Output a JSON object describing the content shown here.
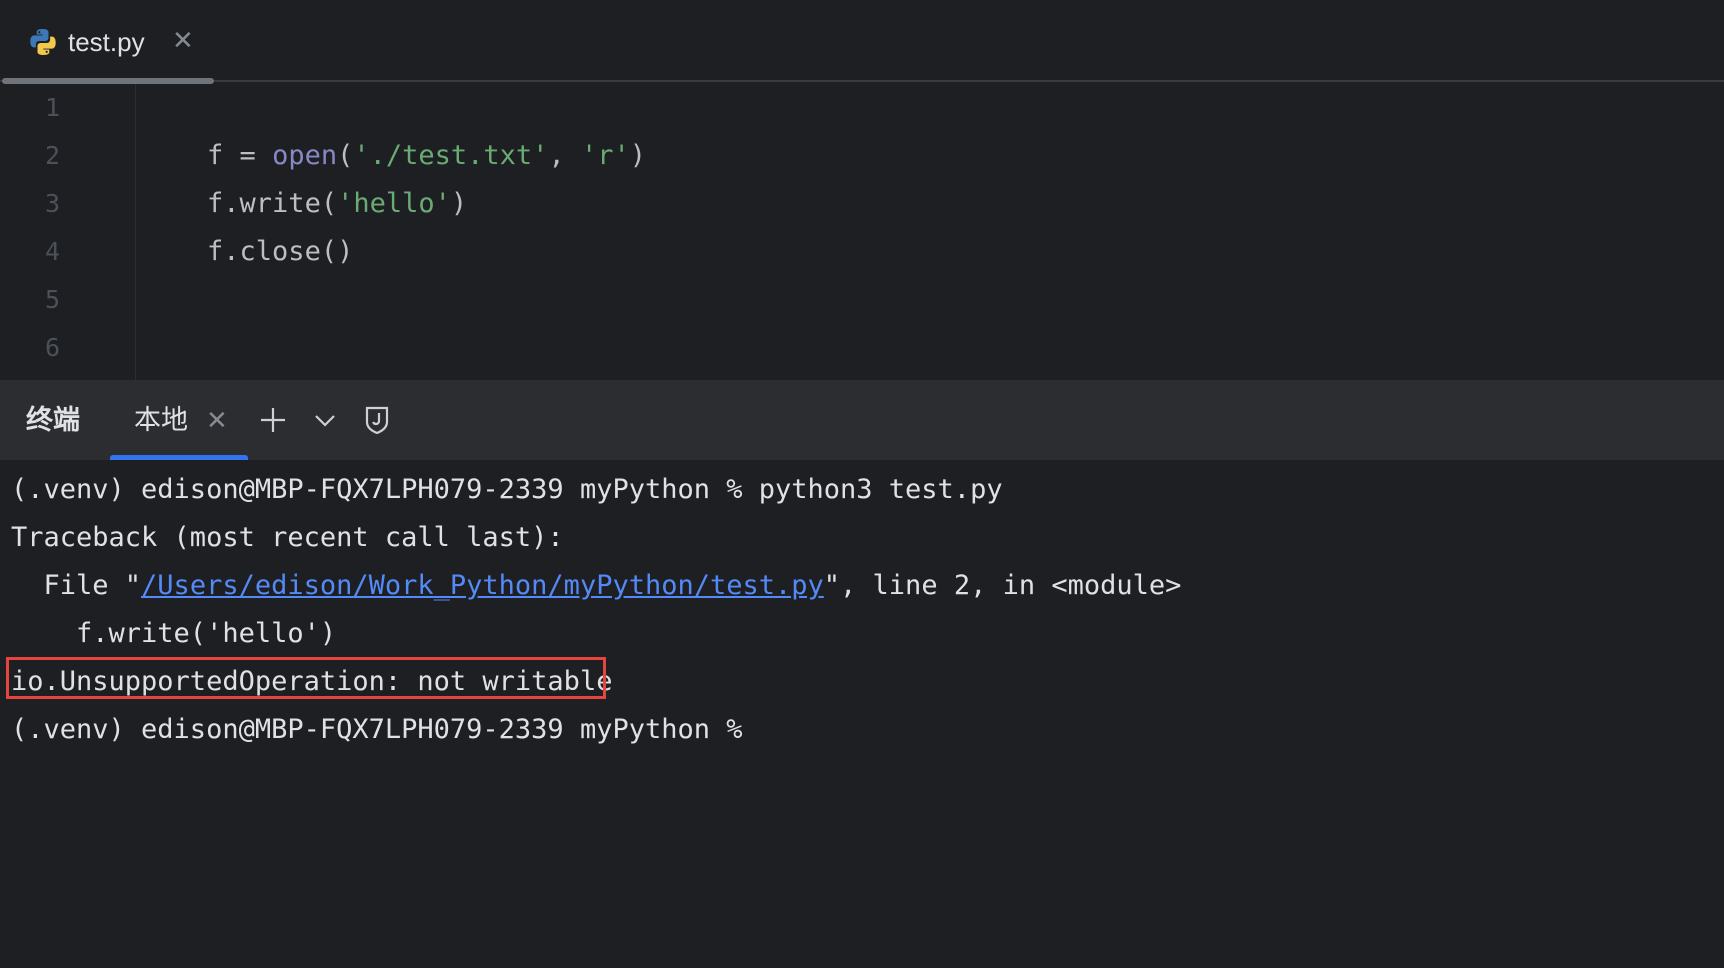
{
  "editor_tab": {
    "filename": "test.py",
    "close_glyph": "✕",
    "icon": "python-icon"
  },
  "editor": {
    "line_numbers": [
      "1",
      "2",
      "3",
      "4",
      "5",
      "6"
    ],
    "lines": [
      [
        {
          "t": "f = ",
          "c": "plain"
        },
        {
          "t": "open",
          "c": "fn"
        },
        {
          "t": "(",
          "c": "plain"
        },
        {
          "t": "'./test.txt'",
          "c": "str"
        },
        {
          "t": ", ",
          "c": "plain"
        },
        {
          "t": "'r'",
          "c": "str"
        },
        {
          "t": ")",
          "c": "plain"
        }
      ],
      [
        {
          "t": "f.write(",
          "c": "plain"
        },
        {
          "t": "'hello'",
          "c": "str"
        },
        {
          "t": ")",
          "c": "plain"
        }
      ],
      [
        {
          "t": "f.close()",
          "c": "plain"
        }
      ]
    ]
  },
  "terminal": {
    "title": "终端",
    "tab_label": "本地",
    "tab_close_glyph": "✕",
    "buttons": [
      "plus-icon",
      "chevron-down-icon",
      "shield-icon"
    ],
    "line1": "(.venv) edison@MBP-FQX7LPH079-2339 myPython % python3 test.py",
    "line2": "Traceback (most recent call last):",
    "line3_pre": "  File \"",
    "line3_link": "/Users/edison/Work_Python/myPython/test.py",
    "line3_post": "\", line 2, in <module>",
    "line4": "    f.write('hello')",
    "line5": "io.UnsupportedOperation: not writable",
    "line6": "(.venv) edison@MBP-FQX7LPH079-2339 myPython %"
  },
  "colors": {
    "background": "#1e1f22",
    "accent": "#3574f0",
    "string": "#6aab73",
    "builtin": "#8888c6",
    "link": "#548af7",
    "error_highlight": "#e5453e"
  }
}
